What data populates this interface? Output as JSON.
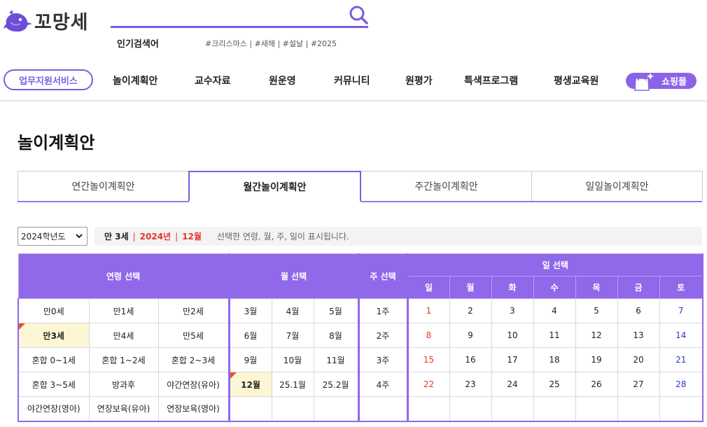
{
  "brand": {
    "name": "꼬망세",
    "accent": "#7c5ce0"
  },
  "search": {
    "popular_label": "인기검색어",
    "popular_tags": "#크리스마스 | #새해 | #설날 | #2025"
  },
  "nav": {
    "pill": "업무지원서비스",
    "items": [
      "놀이계획안",
      "교수자료",
      "원운영",
      "커뮤니티",
      "원평가",
      "특색프로그램",
      "평생교육원"
    ],
    "shop": "쇼핑몰"
  },
  "page": {
    "title": "놀이계획안"
  },
  "tabs": [
    {
      "label": "연간놀이계획안",
      "active": false
    },
    {
      "label": "월간놀이계획안",
      "active": true
    },
    {
      "label": "주간놀이계획안",
      "active": false
    },
    {
      "label": "일일놀이계획안",
      "active": false
    }
  ],
  "filter": {
    "year_select": "2024학년도",
    "selected_age": "만 3세",
    "selected_year": "2024년",
    "selected_month": "12월",
    "desc": "선택한 연령, 월, 주, 일이 표시됩니다."
  },
  "table": {
    "headers": {
      "age": "연령 선택",
      "month": "월 선택",
      "week": "주 선택",
      "day": "일 선택"
    },
    "weekdays": [
      "일",
      "월",
      "화",
      "수",
      "목",
      "금",
      "토"
    ],
    "age_rows": [
      [
        "만0세",
        "만1세",
        "만2세"
      ],
      [
        "만3세",
        "만4세",
        "만5세"
      ],
      [
        "혼합 0~1세",
        "혼합 1~2세",
        "혼합 2~3세"
      ],
      [
        "혼합 3~5세",
        "방과후",
        "야간연장(유아)"
      ],
      [
        "야간연장(영아)",
        "연장보육(유아)",
        "연장보육(영아)"
      ]
    ],
    "month_rows": [
      [
        "3월",
        "4월",
        "5월"
      ],
      [
        "6월",
        "7월",
        "8월"
      ],
      [
        "9월",
        "10월",
        "11월"
      ],
      [
        "12월",
        "25.1월",
        "25.2월"
      ],
      [
        "",
        "",
        ""
      ]
    ],
    "weeks": [
      "1주",
      "2주",
      "3주",
      "4주",
      ""
    ],
    "day_rows": [
      [
        "1",
        "2",
        "3",
        "4",
        "5",
        "6",
        "7"
      ],
      [
        "8",
        "9",
        "10",
        "11",
        "12",
        "13",
        "14"
      ],
      [
        "15",
        "16",
        "17",
        "18",
        "19",
        "20",
        "21"
      ],
      [
        "22",
        "23",
        "24",
        "25",
        "26",
        "27",
        "28"
      ],
      [
        "",
        "",
        "",
        "",
        "",
        "",
        ""
      ]
    ]
  }
}
